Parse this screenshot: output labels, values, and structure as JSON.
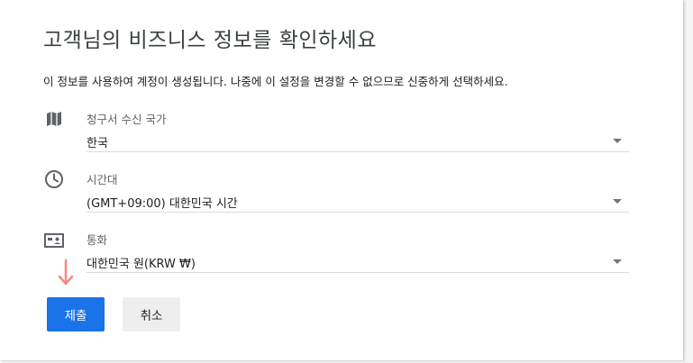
{
  "title": "고객님의 비즈니스 정보를 확인하세요",
  "description": "이 정보를 사용하여 계정이 생성됩니다. 나중에 이 설정을 변경할 수 없으므로 신중하게 선택하세요.",
  "fields": {
    "billing_country": {
      "label": "청구서 수신 국가",
      "value": "한국",
      "icon": "map-icon"
    },
    "timezone": {
      "label": "시간대",
      "value": "(GMT+09:00) 대한민국 시간",
      "icon": "clock-icon"
    },
    "currency": {
      "label": "통화",
      "value": "대한민국 원(KRW ₩)",
      "icon": "currency-card-icon"
    }
  },
  "buttons": {
    "submit": "제출",
    "cancel": "취소"
  },
  "colors": {
    "primary": "#1a73e8",
    "hint_arrow": "#f28b82"
  }
}
